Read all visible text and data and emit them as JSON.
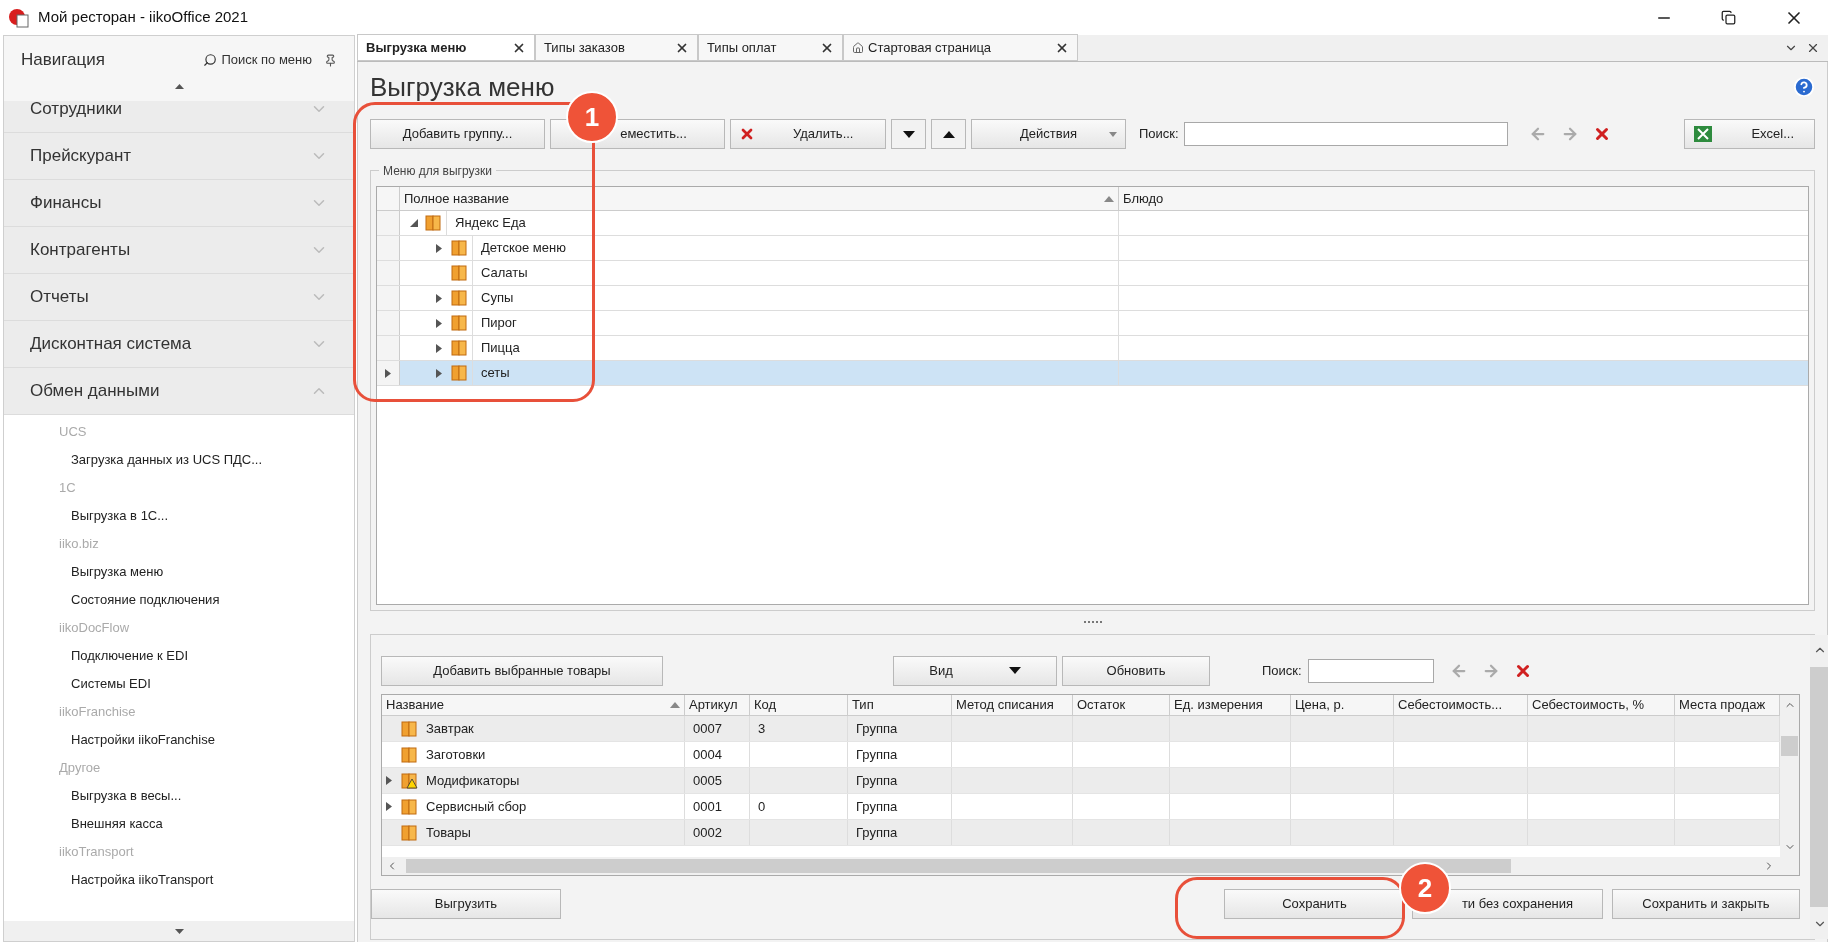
{
  "window": {
    "title": "Мой ресторан - iikoOffice 2021"
  },
  "navigation": {
    "title": "Навигация",
    "search_label": "Поиск по меню",
    "sections": [
      {
        "label": "Сотрудники",
        "expanded": false
      },
      {
        "label": "Прейскурант",
        "expanded": false
      },
      {
        "label": "Финансы",
        "expanded": false
      },
      {
        "label": "Контрагенты",
        "expanded": false
      },
      {
        "label": "Отчеты",
        "expanded": false
      },
      {
        "label": "Дисконтная система",
        "expanded": false
      },
      {
        "label": "Обмен данными",
        "expanded": true
      }
    ],
    "items": [
      {
        "kind": "group",
        "label": "UCS"
      },
      {
        "kind": "link",
        "label": "Загрузка данных из UCS ПДС..."
      },
      {
        "kind": "group",
        "label": "1C"
      },
      {
        "kind": "link",
        "label": "Выгрузка в 1C..."
      },
      {
        "kind": "group",
        "label": "iiko.biz"
      },
      {
        "kind": "link",
        "label": "Выгрузка меню"
      },
      {
        "kind": "link",
        "label": "Состояние подключения"
      },
      {
        "kind": "group",
        "label": "iikoDocFlow"
      },
      {
        "kind": "link",
        "label": "Подключение к EDI"
      },
      {
        "kind": "link",
        "label": "Системы EDI"
      },
      {
        "kind": "group",
        "label": "iikoFranchise"
      },
      {
        "kind": "link",
        "label": "Настройки iikoFranchise"
      },
      {
        "kind": "group",
        "label": "Другое"
      },
      {
        "kind": "link",
        "label": "Выгрузка в весы..."
      },
      {
        "kind": "link",
        "label": "Внешняя касса"
      },
      {
        "kind": "group",
        "label": "iikoTransport"
      },
      {
        "kind": "link",
        "label": "Настройка iikoTransport"
      }
    ]
  },
  "tabs": [
    {
      "label": "Выгрузка меню",
      "selected": true,
      "home": false
    },
    {
      "label": "Типы заказов",
      "selected": false,
      "home": false
    },
    {
      "label": "Типы оплат",
      "selected": false,
      "home": false
    },
    {
      "label": "Стартовая страница",
      "selected": false,
      "home": true
    }
  ],
  "page_title": "Выгрузка меню",
  "toolbar": {
    "add_group": "Добавить группу...",
    "move": "еместить...",
    "delete": "Удалить...",
    "actions": "Действия",
    "search_label": "Поиск:",
    "excel": "Excel..."
  },
  "menu_group": {
    "title": "Меню для выгрузки",
    "columns": [
      "Полное название",
      "Блюдо"
    ],
    "tree": [
      {
        "name": "Яндекс Еда",
        "kind": "branch",
        "expanded": true,
        "selected": false,
        "children": [
          {
            "name": "Детское меню",
            "kind": "branch",
            "expanded": false,
            "selected": false
          },
          {
            "name": "Салаты",
            "kind": "leaf",
            "selected": false
          },
          {
            "name": "Супы",
            "kind": "branch",
            "expanded": false,
            "selected": false
          },
          {
            "name": "Пирог",
            "kind": "branch",
            "expanded": false,
            "selected": false
          },
          {
            "name": "Пицца",
            "kind": "branch",
            "expanded": false,
            "selected": false
          },
          {
            "name": "сеты",
            "kind": "branch",
            "expanded": false,
            "selected": true
          }
        ]
      }
    ]
  },
  "products": {
    "add_selected": "Добавить выбранные товары",
    "view": "Вид",
    "refresh": "Обновить",
    "search_label": "Поиск:",
    "columns": [
      "Название",
      "Артикул",
      "Код",
      "Тип",
      "Метод списания",
      "Остаток",
      "Ед. измерения",
      "Цена, р.",
      "Себестоимость...",
      "Себестоимость, %",
      "Места продаж"
    ],
    "rows": [
      {
        "kind": "leaf",
        "warning": false,
        "cells": [
          "Завтрак",
          "0007",
          "3",
          "Группа"
        ]
      },
      {
        "kind": "leaf",
        "warning": false,
        "cells": [
          "Заготовки",
          "0004",
          "",
          "Группа"
        ]
      },
      {
        "kind": "branch",
        "warning": true,
        "cells": [
          "Модификаторы",
          "0005",
          "",
          "Группа"
        ]
      },
      {
        "kind": "branch",
        "warning": false,
        "cells": [
          "Сервисный сбор",
          "0001",
          "0",
          "Группа"
        ]
      },
      {
        "kind": "leaf",
        "warning": false,
        "cells": [
          "Товары",
          "0002",
          "",
          "Группа"
        ]
      }
    ]
  },
  "footer": {
    "export": "Выгрузить",
    "save": "Сохранить",
    "exit": "ти без сохранения",
    "save_close": "Сохранить и закрыть"
  },
  "annotations": [
    {
      "label": "1"
    },
    {
      "label": "2"
    }
  ]
}
